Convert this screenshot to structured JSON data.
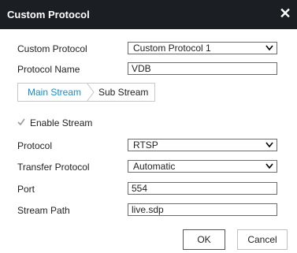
{
  "dialog": {
    "title": "Custom Protocol"
  },
  "fields": {
    "custom_protocol": {
      "label": "Custom Protocol",
      "value": "Custom Protocol 1"
    },
    "protocol_name": {
      "label": "Protocol Name",
      "value": "VDB"
    }
  },
  "tabs": [
    {
      "label": "Main Stream",
      "active": true
    },
    {
      "label": "Sub Stream",
      "active": false
    }
  ],
  "stream": {
    "enable_label": "Enable Stream",
    "enable_checked": true,
    "protocol": {
      "label": "Protocol",
      "value": "RTSP"
    },
    "transfer_protocol": {
      "label": "Transfer Protocol",
      "value": "Automatic"
    },
    "port": {
      "label": "Port",
      "value": "554"
    },
    "stream_path": {
      "label": "Stream Path",
      "value": "live.sdp"
    }
  },
  "buttons": {
    "ok": "OK",
    "cancel": "Cancel"
  },
  "icons": {
    "close": "close-icon",
    "dropdown": "chevron-down-icon",
    "check": "check-icon"
  },
  "colors": {
    "titlebar": "#1b1e22",
    "active_tab": "#1a8bd0"
  }
}
